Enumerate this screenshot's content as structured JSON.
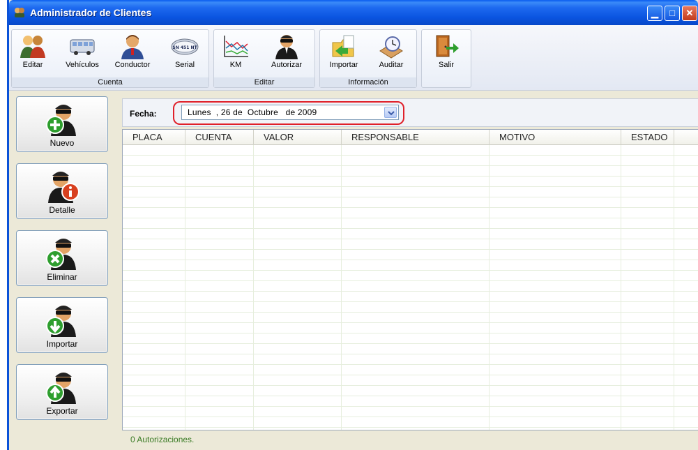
{
  "window": {
    "title": "Administrador de Clientes",
    "controls": [
      "minimize-icon",
      "maximize-icon",
      "close-icon"
    ]
  },
  "ribbon": {
    "groups": [
      {
        "caption": "Cuenta",
        "buttons": [
          {
            "label": "Editar",
            "icon": "users-icon"
          },
          {
            "label": "Vehículos",
            "icon": "bus-icon"
          },
          {
            "label": "Conductor",
            "icon": "driver-icon"
          },
          {
            "label": "Serial",
            "icon": "license-plate-icon"
          }
        ]
      },
      {
        "caption": "Editar",
        "buttons": [
          {
            "label": "KM",
            "icon": "line-chart-icon"
          },
          {
            "label": "Autorizar",
            "icon": "agent-icon"
          }
        ]
      },
      {
        "caption": "Información",
        "buttons": [
          {
            "label": "Importar",
            "icon": "import-folder-icon"
          },
          {
            "label": "Auditar",
            "icon": "audit-clock-icon"
          }
        ]
      },
      {
        "caption": "",
        "buttons": [
          {
            "label": "Salir",
            "icon": "exit-door-icon"
          }
        ]
      }
    ],
    "plate_text": "SN 451 NT"
  },
  "actions": [
    {
      "label": "Nuevo",
      "icon": "agent-add-icon",
      "badge_color": "#2E9E2E"
    },
    {
      "label": "Detalle",
      "icon": "agent-info-icon",
      "badge_color": "#D8401F"
    },
    {
      "label": "Eliminar",
      "icon": "agent-delete-icon",
      "badge_color": "#2E9E2E"
    },
    {
      "label": "Importar",
      "icon": "agent-import-icon",
      "badge_color": "#2E9E2E"
    },
    {
      "label": "Exportar",
      "icon": "agent-export-icon",
      "badge_color": "#2E9E2E"
    }
  ],
  "filter": {
    "label": "Fecha:",
    "date_value": "Lunes  , 26 de  Octubre   de 2009"
  },
  "table": {
    "columns": [
      "PLACA",
      "CUENTA",
      "VALOR",
      "RESPONSABLE",
      "MOTIVO",
      "ESTADO"
    ],
    "rows": []
  },
  "status": {
    "text": "0 Autorizaciones."
  },
  "colors": {
    "title_bar": "#0A54E0",
    "highlight_ring": "#E0202A",
    "status_text": "#3A7B25",
    "row_line": "#E6EEDD"
  }
}
